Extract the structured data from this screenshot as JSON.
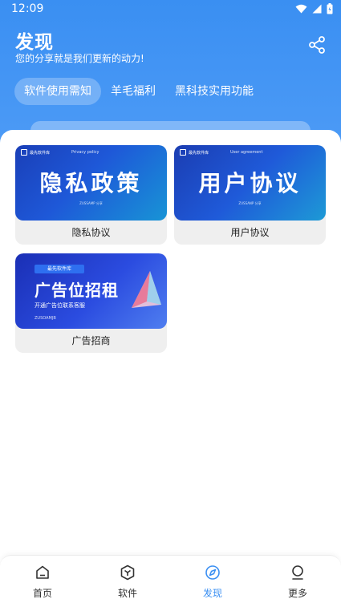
{
  "status": {
    "time": "12:09"
  },
  "header": {
    "title": "发现",
    "subtitle": "您的分享就是我们更新的动力!"
  },
  "tabs": [
    {
      "label": "软件使用需知",
      "active": true
    },
    {
      "label": "羊毛福利",
      "active": false
    },
    {
      "label": "黑科技实用功能",
      "active": false
    }
  ],
  "cards": [
    {
      "label": "隐私协议",
      "banner": {
        "brand": "最先软件库",
        "en": "Privacy policy",
        "big": "隐私政策",
        "small": "ZUSSAMP 分享"
      }
    },
    {
      "label": "用户协议",
      "banner": {
        "brand": "最先软件库",
        "en": "User agreement",
        "big": "用户协议",
        "small": "ZUSSANP 分享"
      }
    },
    {
      "label": "广告招商",
      "banner": {
        "brand": "最先软件库",
        "big": "广告位招租",
        "line": "开通广告位联系客服",
        "small": "ZUSOAMJB"
      }
    }
  ],
  "nav": [
    {
      "label": "首页",
      "icon": "home-icon",
      "active": false
    },
    {
      "label": "软件",
      "icon": "cube-icon",
      "active": false
    },
    {
      "label": "发现",
      "icon": "compass-icon",
      "active": true
    },
    {
      "label": "更多",
      "icon": "user-icon",
      "active": false
    }
  ],
  "colors": {
    "primary": "#3a8ff2",
    "nav_active": "#3a8ff2"
  }
}
